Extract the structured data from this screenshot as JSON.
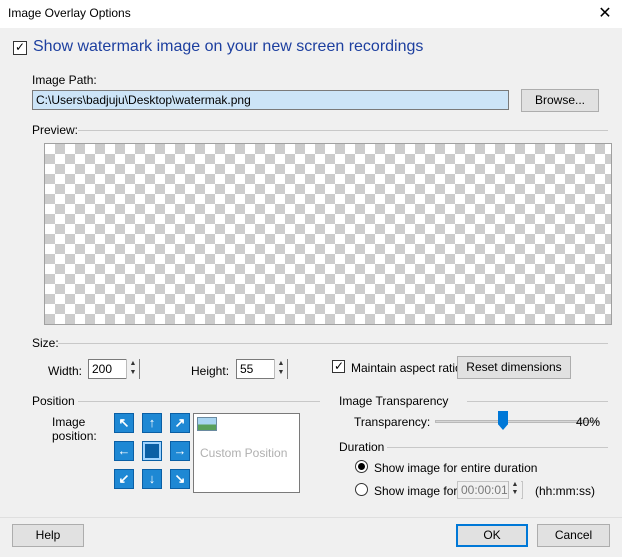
{
  "window": {
    "title": "Image Overlay Options",
    "close_glyph": "✕"
  },
  "watermark_checkbox": {
    "label": "Show watermark image on your new screen recordings",
    "checked": true
  },
  "image_path": {
    "label": "Image Path:",
    "value": "C:\\Users\\badjuju\\Desktop\\watermak.png",
    "browse_label": "Browse..."
  },
  "preview": {
    "label": "Preview:"
  },
  "size": {
    "label": "Size:",
    "width_label": "Width:",
    "width_value": "200",
    "height_label": "Height:",
    "height_value": "55",
    "aspect_label": "Maintain aspect ratio",
    "aspect_checked": true,
    "reset_label": "Reset dimensions"
  },
  "position": {
    "label": "Position",
    "image_position_label_line1": "Image",
    "image_position_label_line2": "position:",
    "buttons": [
      "↖",
      "↑",
      "↗",
      "←",
      "",
      "→",
      "↙",
      "↓",
      "↘"
    ],
    "custom_label": "Custom Position"
  },
  "transparency": {
    "group_label": "Image Transparency",
    "label": "Transparency:",
    "value": "40%",
    "level_percent": 40
  },
  "duration": {
    "label": "Duration",
    "entire_label": "Show image for entire duration",
    "entire_selected": true,
    "for_label": "Show image for",
    "time_value": "00:00:01",
    "time_format": "(hh:mm:ss)"
  },
  "footer": {
    "help_label": "Help",
    "ok_label": "OK",
    "cancel_label": "Cancel"
  },
  "colors": {
    "accent": "#0078d7",
    "heading_blue": "#1d3f9f",
    "position_button": "#1e88d4",
    "path_selected_bg": "#cce4f7"
  }
}
